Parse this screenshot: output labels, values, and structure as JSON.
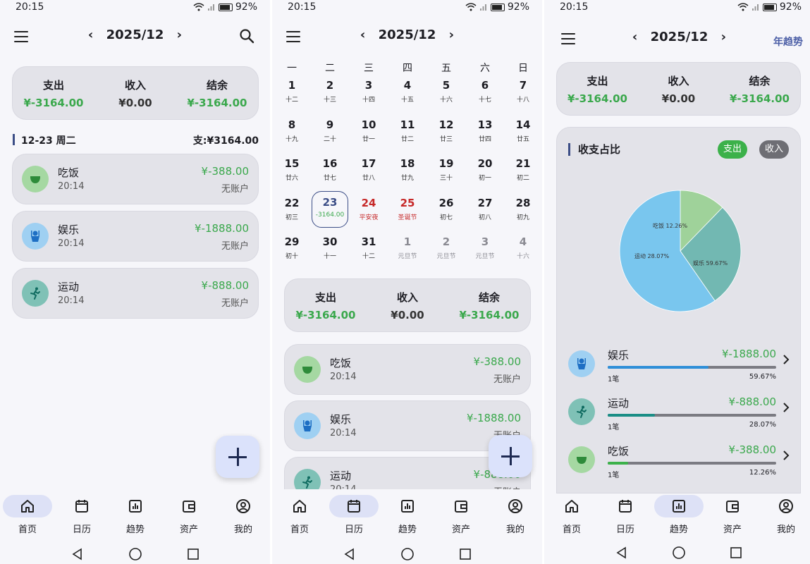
{
  "status": {
    "time1": "20:15",
    "time2": "20:15",
    "time3": "20:15",
    "battery": "92%"
  },
  "header": {
    "month": "2025/12",
    "year_trend": "年趋势"
  },
  "summary": {
    "expense_label": "支出",
    "income_label": "收入",
    "balance_label": "结余",
    "expense": "¥-3164.00",
    "income": "¥0.00",
    "balance": "¥-3164.00"
  },
  "day_header": {
    "date": "12-23 周二",
    "total": "支:¥3164.00"
  },
  "transactions": [
    {
      "name": "吃饭",
      "time": "20:14",
      "amount": "¥-388.00",
      "account": "无账户",
      "icon": "bowl-icon"
    },
    {
      "name": "娱乐",
      "time": "20:14",
      "amount": "¥-1888.00",
      "account": "无账户",
      "icon": "puppet-icon"
    },
    {
      "name": "运动",
      "time": "20:14",
      "amount": "¥-888.00",
      "account": "无账户",
      "icon": "running-icon"
    }
  ],
  "calendar": {
    "weekdays": [
      "一",
      "二",
      "三",
      "四",
      "五",
      "六",
      "日"
    ],
    "weeks": [
      [
        {
          "n": "1",
          "s": "十二"
        },
        {
          "n": "2",
          "s": "十三"
        },
        {
          "n": "3",
          "s": "十四"
        },
        {
          "n": "4",
          "s": "十五"
        },
        {
          "n": "5",
          "s": "十六"
        },
        {
          "n": "6",
          "s": "十七"
        },
        {
          "n": "7",
          "s": "十八"
        }
      ],
      [
        {
          "n": "8",
          "s": "十九"
        },
        {
          "n": "9",
          "s": "二十"
        },
        {
          "n": "10",
          "s": "廿一"
        },
        {
          "n": "11",
          "s": "廿二"
        },
        {
          "n": "12",
          "s": "廿三"
        },
        {
          "n": "13",
          "s": "廿四"
        },
        {
          "n": "14",
          "s": "廿五"
        }
      ],
      [
        {
          "n": "15",
          "s": "廿六"
        },
        {
          "n": "16",
          "s": "廿七"
        },
        {
          "n": "17",
          "s": "廿八"
        },
        {
          "n": "18",
          "s": "廿九"
        },
        {
          "n": "19",
          "s": "三十"
        },
        {
          "n": "20",
          "s": "初一"
        },
        {
          "n": "21",
          "s": "初二"
        }
      ],
      [
        {
          "n": "22",
          "s": "初三"
        },
        {
          "n": "23",
          "s": "-3164.00",
          "selected": true
        },
        {
          "n": "24",
          "s": "平安夜",
          "red": true
        },
        {
          "n": "25",
          "s": "圣诞节",
          "red": true
        },
        {
          "n": "26",
          "s": "初七"
        },
        {
          "n": "27",
          "s": "初八"
        },
        {
          "n": "28",
          "s": "初九"
        }
      ],
      [
        {
          "n": "29",
          "s": "初十"
        },
        {
          "n": "30",
          "s": "十一"
        },
        {
          "n": "31",
          "s": "十二"
        },
        {
          "n": "1",
          "s": "元旦节",
          "other": true
        },
        {
          "n": "2",
          "s": "元旦节",
          "other": true
        },
        {
          "n": "3",
          "s": "元旦节",
          "other": true
        },
        {
          "n": "4",
          "s": "十六",
          "other": true
        }
      ]
    ]
  },
  "trend": {
    "section_title": "收支占比",
    "toggle_expense": "支出",
    "toggle_income": "收入",
    "colors": {
      "entertainment": "#79c6ee",
      "sport": "#72b8b2",
      "food": "#9fd29a",
      "active_toggle": "#3cb14a",
      "inactive_toggle": "#6e6e74"
    },
    "categories": [
      {
        "name": "娱乐",
        "amount": "¥-1888.00",
        "count": "1笔",
        "percent": "59.67%",
        "ratio": 0.5967,
        "bar_color": "#2f8fd8"
      },
      {
        "name": "运动",
        "amount": "¥-888.00",
        "count": "1笔",
        "percent": "28.07%",
        "ratio": 0.2807,
        "bar_color": "#1b8e86"
      },
      {
        "name": "吃饭",
        "amount": "¥-388.00",
        "count": "1笔",
        "percent": "12.26%",
        "ratio": 0.1226,
        "bar_color": "#3cb14a"
      }
    ]
  },
  "chart_data": {
    "type": "pie",
    "labels": [
      "娱乐 59.67%",
      "运动 28.07%",
      "吃饭 12.26%"
    ],
    "values": [
      59.67,
      28.07,
      12.26
    ],
    "colors": [
      "#79c6ee",
      "#72b8b2",
      "#9fd29a"
    ]
  },
  "nav": {
    "home": "首页",
    "calendar": "日历",
    "trend": "趋势",
    "assets": "资产",
    "mine": "我的"
  }
}
